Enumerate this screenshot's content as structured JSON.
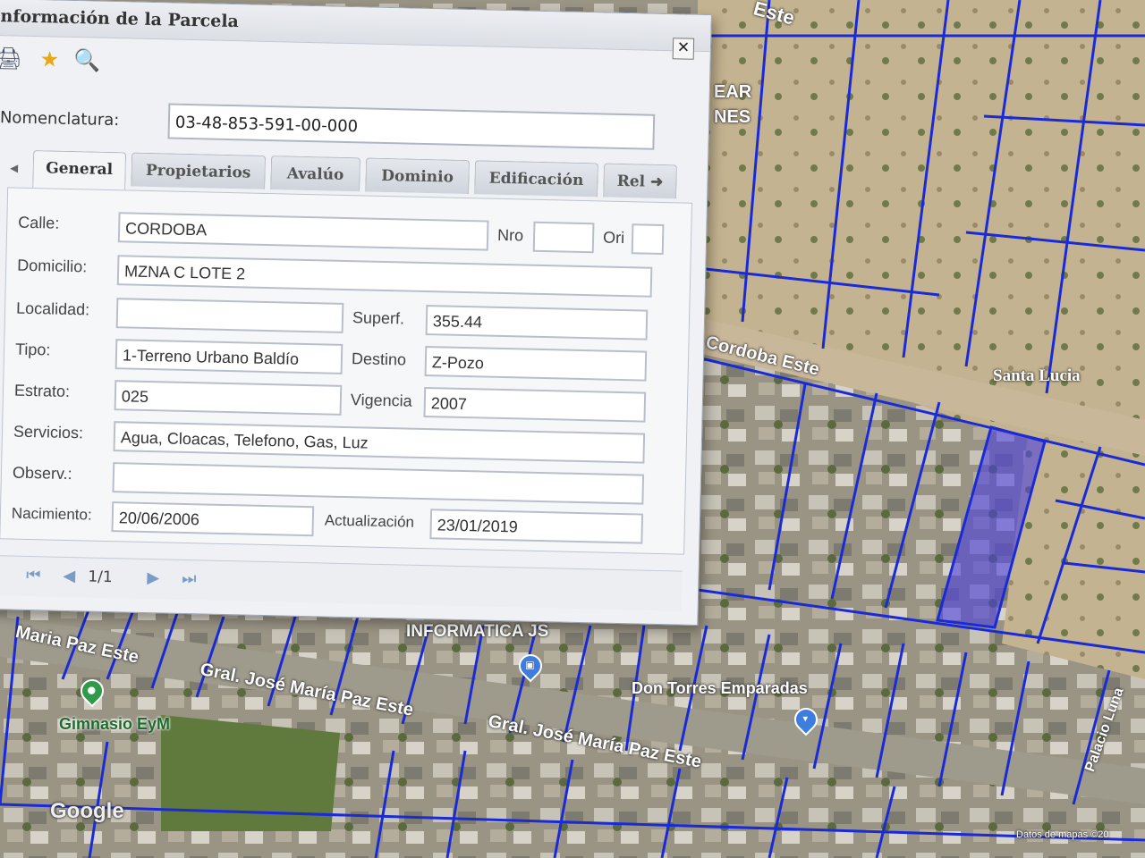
{
  "dialog": {
    "title": "nformación de la Parcela",
    "close_label": "✕",
    "toolbar": [
      {
        "name": "print-icon",
        "glyph": "🖨"
      },
      {
        "name": "star-icon",
        "glyph": "★"
      },
      {
        "name": "search-icon",
        "glyph": "🔍"
      }
    ],
    "nomenclatura_label": "Nomenclatura:",
    "nomenclatura_value": "03-48-853-591-00-000",
    "tabs": [
      "General",
      "Propietarios",
      "Avalúo",
      "Dominio",
      "Edificación",
      "Rel"
    ],
    "active_tab": "General",
    "fields": {
      "calle_label": "Calle:",
      "calle_value": "CORDOBA",
      "nro_label": "Nro",
      "nro_value": "",
      "ori_label": "Ori",
      "ori_value": "",
      "domicilio_label": "Domicilio:",
      "domicilio_value": "MZNA C LOTE 2",
      "localidad_label": "Localidad:",
      "localidad_value": "",
      "superf_label": "Superf.",
      "superf_value": "355.44",
      "tipo_label": "Tipo:",
      "tipo_value": "1-Terreno Urbano Baldío",
      "destino_label": "Destino",
      "destino_value": "Z-Pozo",
      "estrato_label": "Estrato:",
      "estrato_value": "025",
      "vigencia_label": "Vigencia",
      "vigencia_value": "2007",
      "servicios_label": "Servicios:",
      "servicios_value": "Agua, Cloacas, Telefono, Gas, Luz",
      "observ_label": "Observ.:",
      "observ_value": "",
      "nacimiento_label": "Nacimiento:",
      "nacimiento_value": "20/06/2006",
      "actualizacion_label": "Actualización",
      "actualizacion_value": "23/01/2019"
    },
    "pager": {
      "text": "1/1"
    }
  },
  "map": {
    "labels": {
      "cordoba_este": "Cordoba Este",
      "santa_lucia": "Santa Lucia",
      "maria_paz_este": "Maria Paz Este",
      "gral_jose_maria_paz_este_1": "Gral. José María Paz Este",
      "gral_jose_maria_paz_este_2": "Gral. José María Paz Este",
      "informatica": "INFORMATICA JS",
      "don_torres": "Don Torres Emparadas",
      "gimnasio": "Gimnasio EyM",
      "palacio": "Palacio Luna",
      "ear": "EAR",
      "nes": "NES",
      "este_top": "Este",
      "google": "Google",
      "datos": "Datos de mapas ©20"
    },
    "colors": {
      "parcel_lines": "#1a2bd6",
      "selected_parcel": "#4b3fe0",
      "road": "#c9b79a"
    }
  }
}
